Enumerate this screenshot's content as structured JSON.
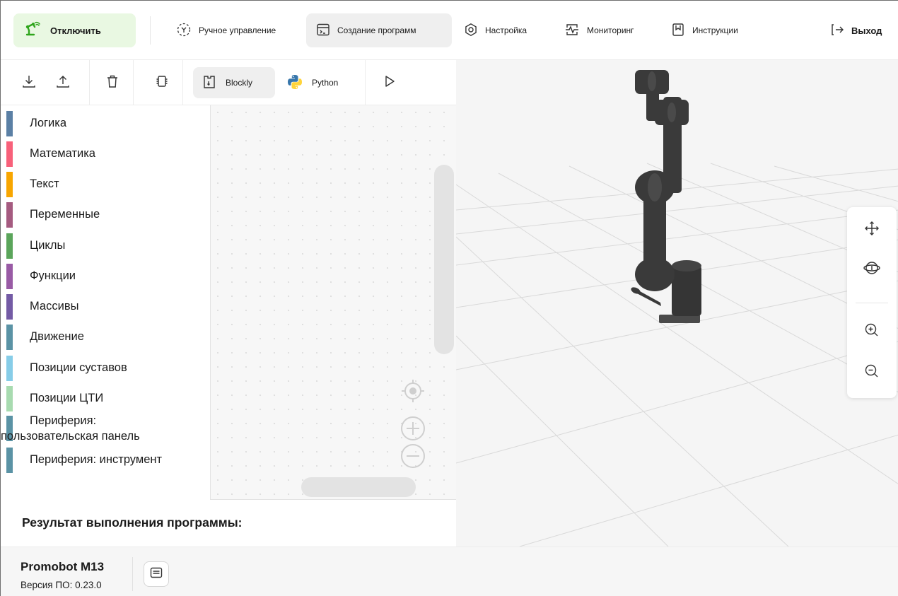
{
  "topbar": {
    "disconnect_label": "Отключить",
    "nav": [
      {
        "label": "Ручное управление",
        "icon": "manual-control-icon"
      },
      {
        "label": "Создание программ",
        "icon": "program-editor-icon",
        "active": true
      },
      {
        "label": "Настройка",
        "icon": "settings-icon"
      },
      {
        "label": "Мониторинг",
        "icon": "monitoring-icon"
      },
      {
        "label": "Инструкции",
        "icon": "instructions-icon"
      }
    ],
    "exit_label": "Выход"
  },
  "editor": {
    "toolbar": {
      "tools": [
        "download-icon",
        "upload-icon",
        "trash-icon",
        "chip-icon"
      ],
      "tabs": [
        {
          "label": "Blockly",
          "icon": "blockly-icon",
          "active": true
        },
        {
          "label": "Python",
          "icon": "python-icon"
        }
      ],
      "run_icon": "play-icon"
    },
    "categories": [
      {
        "label": "Логика",
        "color": "#5b80a5"
      },
      {
        "label": "Математика",
        "color": "#f8617a"
      },
      {
        "label": "Текст",
        "color": "#f8a600"
      },
      {
        "label": "Переменные",
        "color": "#a55b80"
      },
      {
        "label": "Циклы",
        "color": "#5ba55b"
      },
      {
        "label": "Функции",
        "color": "#995ba5"
      },
      {
        "label": "Массивы",
        "color": "#745ba5"
      },
      {
        "label": "Движение",
        "color": "#5b93a5"
      },
      {
        "label": "Позиции суставов",
        "color": "#87cde8"
      },
      {
        "label": "Позиции ЦТИ",
        "color": "#a8dbb0"
      },
      {
        "label_line1": "Периферия:",
        "label_line2": "пользовательская панель",
        "color": "#5b93a5"
      },
      {
        "label": "Периферия: инструмент",
        "color": "#5b93a5"
      }
    ],
    "result_label": "Результат выполнения программы:"
  },
  "viewport": {
    "tools": [
      "move-icon",
      "orbit-icon",
      "zoom-in-icon",
      "zoom-out-icon"
    ]
  },
  "footer": {
    "device_name": "Promobot M13",
    "firmware_version": "Версия ПО: 0.23.0"
  },
  "colors": {
    "accent_green": "#2fa51c",
    "disconnect_bg": "#e9f8e2",
    "active_bg": "#efefef",
    "robot": "#3a3a3a"
  }
}
